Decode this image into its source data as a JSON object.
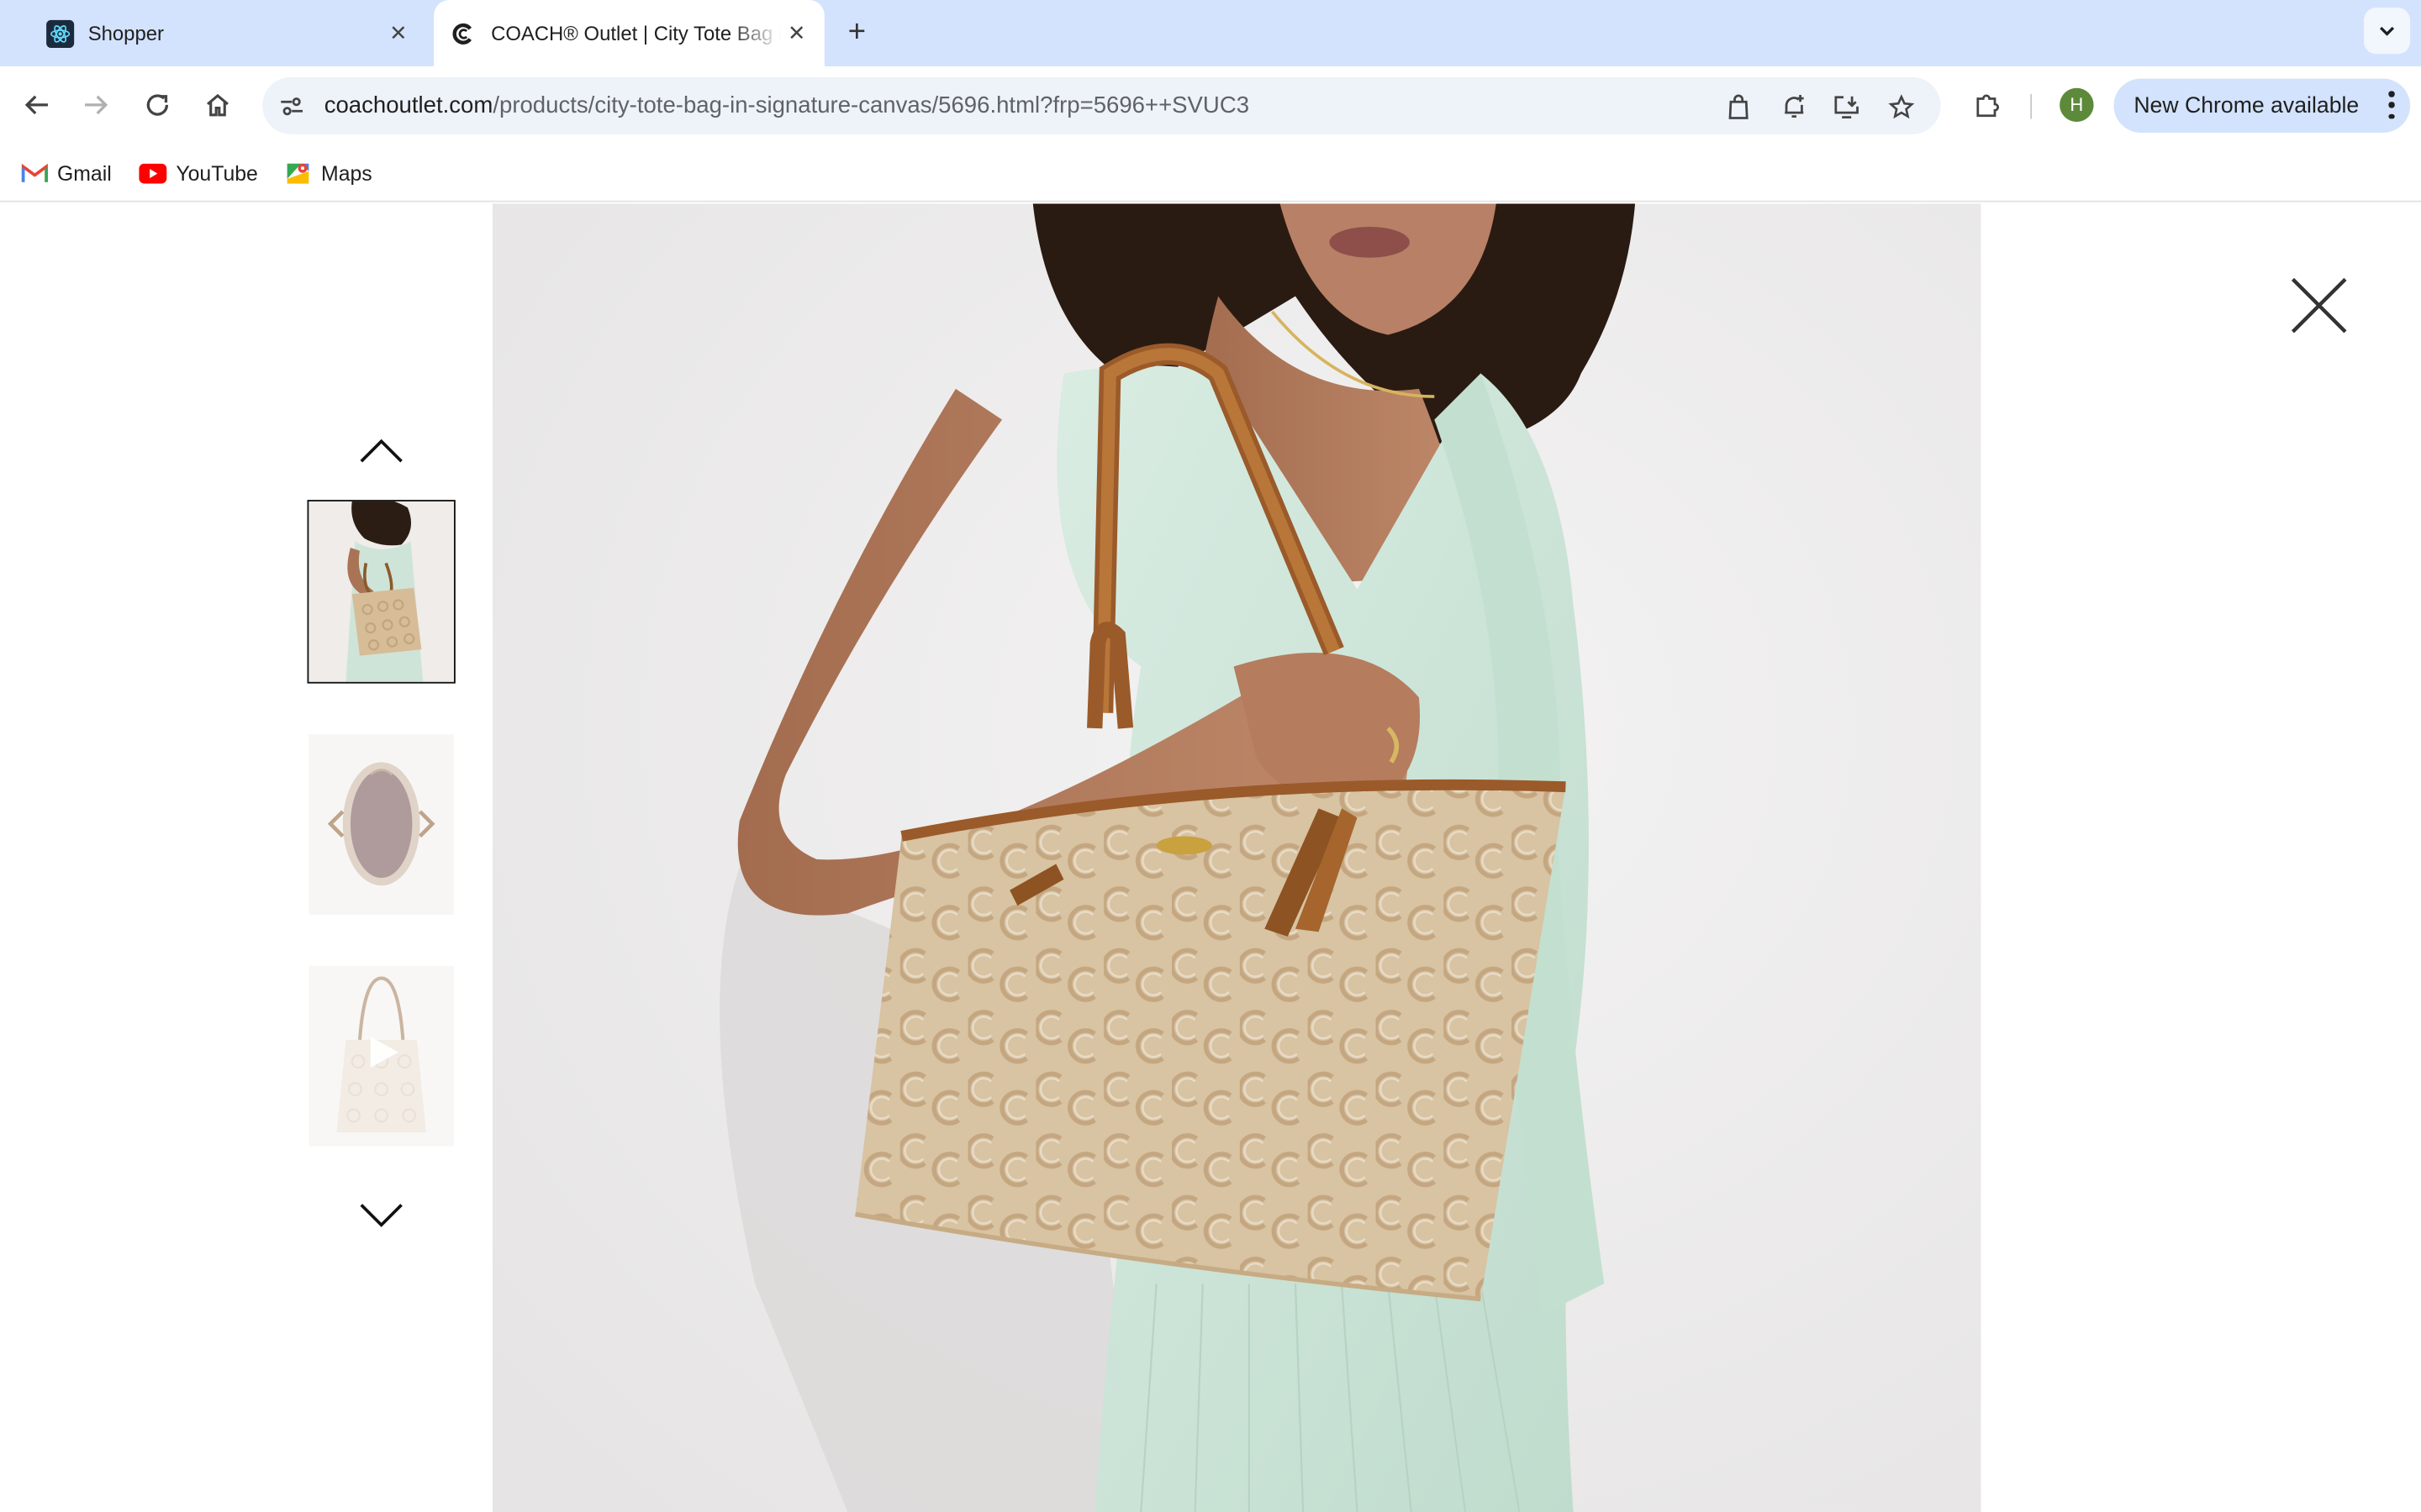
{
  "browser": {
    "tabs": [
      {
        "title": "Shopper",
        "active": false,
        "favicon": "react-atom-icon"
      },
      {
        "title": "COACH® Outlet | City Tote Bag in Signature Canvas",
        "active": true,
        "favicon": "coach-c-icon"
      }
    ],
    "new_tab_label": "+",
    "url_host": "coachoutlet.com",
    "url_path": "/products/city-tote-bag-in-signature-canvas/5696.html?frp=5696++SVUC3",
    "profile_initial": "H",
    "update_label": "New Chrome available",
    "colors": {
      "tab_strip": "#d3e3fd",
      "omnibox": "#eef2f9",
      "avatar": "#5d8a3a"
    }
  },
  "bookmarks": [
    {
      "label": "Gmail",
      "icon": "gmail-icon"
    },
    {
      "label": "YouTube",
      "icon": "youtube-icon"
    },
    {
      "label": "Maps",
      "icon": "maps-icon"
    }
  ],
  "gallery": {
    "thumbnails": [
      {
        "name": "model-wearing-tote",
        "selected": true
      },
      {
        "name": "tote-interior-top-view",
        "selected": false
      },
      {
        "name": "tote-video",
        "selected": false,
        "has_play_icon": true
      }
    ],
    "main_image": "woman-in-mint-dress-carrying-signature-canvas-tote",
    "icons": {
      "previous": "chevron-up-icon",
      "next": "chevron-down-icon",
      "close": "close-icon"
    }
  }
}
